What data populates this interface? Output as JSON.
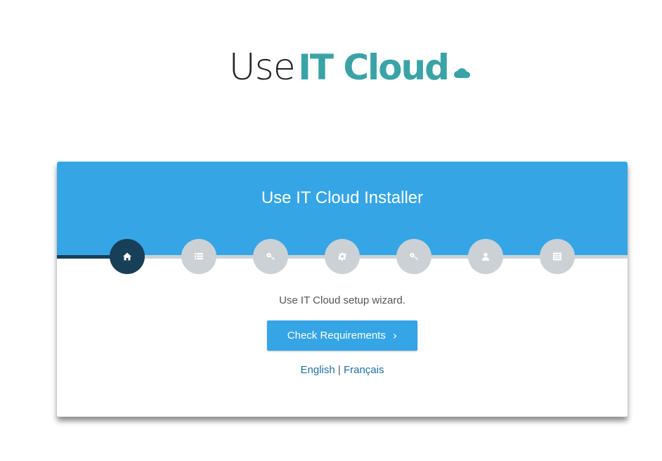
{
  "logo": {
    "light_text": "Use",
    "bold_text": "IT Cloud",
    "cloud_icon": "cloud-icon"
  },
  "installer": {
    "title": "Use IT Cloud Installer",
    "subtitle": "Use IT Cloud setup wizard.",
    "check_button_label": "Check Requirements",
    "check_button_icon": "chevron-right-icon"
  },
  "steps": [
    {
      "icon": "home-icon",
      "active": true
    },
    {
      "icon": "list-icon",
      "active": false
    },
    {
      "icon": "key-icon",
      "active": false
    },
    {
      "icon": "gear-icon",
      "active": false
    },
    {
      "icon": "key-icon",
      "active": false
    },
    {
      "icon": "user-icon",
      "active": false
    },
    {
      "icon": "server-icon",
      "active": false
    }
  ],
  "languages": {
    "english": "English",
    "separator": "|",
    "french": "Français"
  },
  "colors": {
    "header_blue": "#35a5e5",
    "logo_teal": "#3aa3a6",
    "step_active": "#173f58",
    "step_inactive": "#cbd1d5",
    "link": "#1e6ea8"
  }
}
